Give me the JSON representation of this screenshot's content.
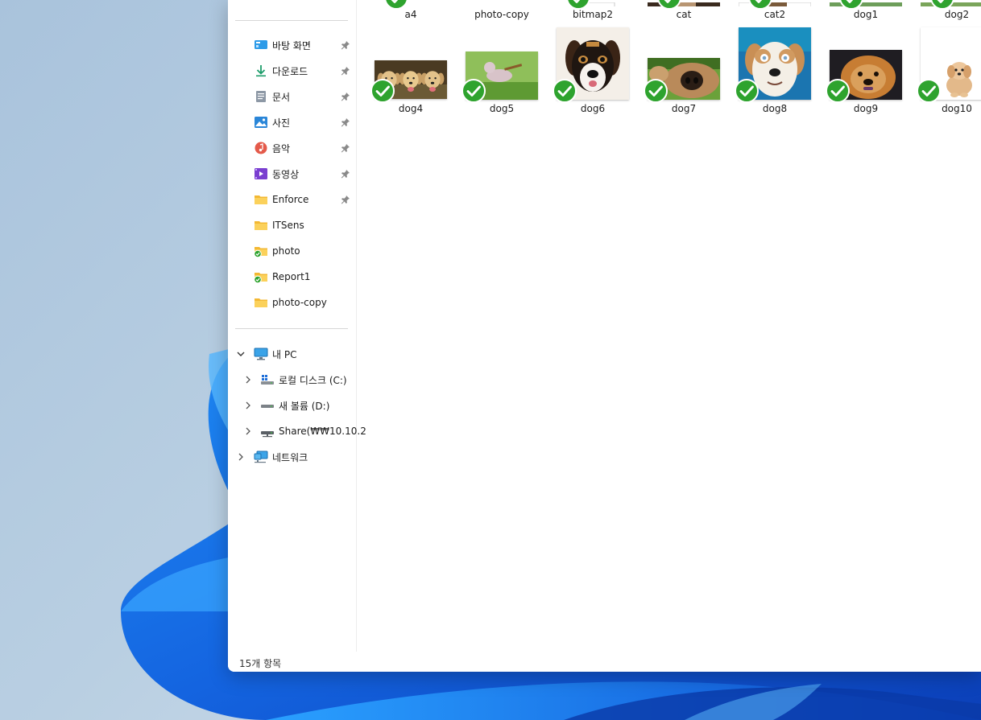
{
  "sidebar": {
    "quick_access": [
      {
        "label": "바탕 화면",
        "icon": "desktop-icon",
        "pinned": true
      },
      {
        "label": "다운로드",
        "icon": "download-icon",
        "pinned": true
      },
      {
        "label": "문서",
        "icon": "document-icon",
        "pinned": true
      },
      {
        "label": "사진",
        "icon": "pictures-icon",
        "pinned": true
      },
      {
        "label": "음악",
        "icon": "music-icon",
        "pinned": true
      },
      {
        "label": "동영상",
        "icon": "video-icon",
        "pinned": true
      },
      {
        "label": "Enforce",
        "icon": "folder-icon",
        "pinned": true
      },
      {
        "label": "ITSens",
        "icon": "folder-icon",
        "pinned": false
      },
      {
        "label": "photo",
        "icon": "folder-synced-icon",
        "pinned": false
      },
      {
        "label": "Report1",
        "icon": "folder-synced-icon",
        "pinned": false
      },
      {
        "label": "photo-copy",
        "icon": "folder-icon",
        "pinned": false
      }
    ],
    "this_pc": {
      "label": "내 PC",
      "icon": "computer-icon",
      "expanded": true,
      "drives": [
        {
          "label": "로컬 디스크 (C:)",
          "icon": "windows-drive-icon"
        },
        {
          "label": "새 볼륨 (D:)",
          "icon": "drive-icon"
        },
        {
          "label": "Share(₩₩10.10.2",
          "icon": "network-drive-icon"
        }
      ]
    },
    "network": {
      "label": "네트워크",
      "icon": "network-icon"
    }
  },
  "files": {
    "row1": [
      "a4",
      "photo-copy",
      "bitmap2",
      "cat",
      "cat2",
      "dog1",
      "dog2"
    ],
    "row2": [
      "dog4",
      "dog5",
      "dog6",
      "dog7",
      "dog8",
      "dog9",
      "dog10"
    ]
  },
  "status_bar": {
    "count": "15개 항목"
  },
  "colors": {
    "accent": "#1e6ed8",
    "sync_green": "#2ea32e",
    "folder_yellow": "#f8c846"
  }
}
